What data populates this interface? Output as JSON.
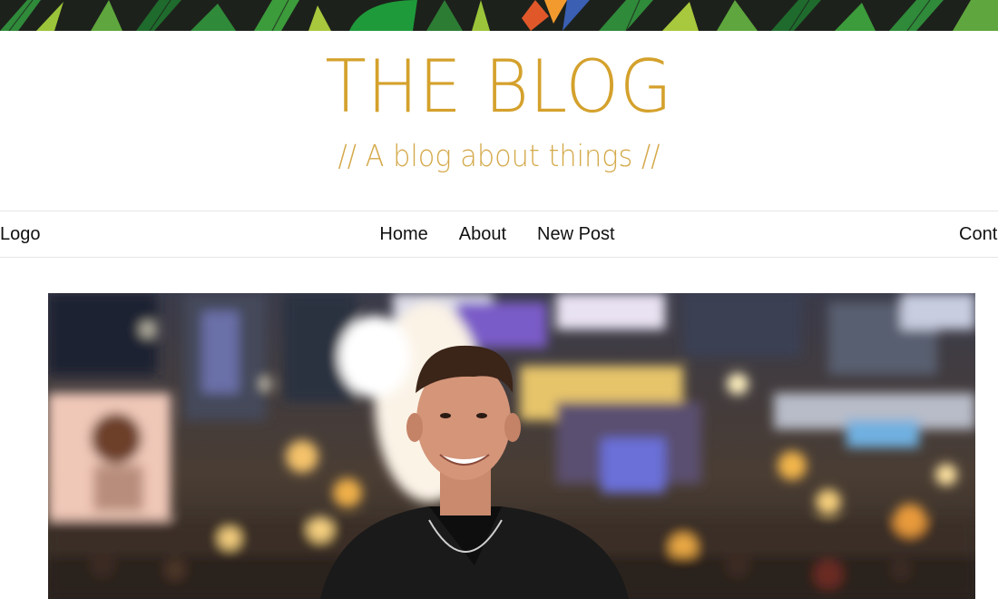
{
  "site": {
    "title": "THE BLOG",
    "tagline": "// A blog about things //",
    "title_color": "#d4a12c"
  },
  "nav": {
    "logo": "Logo",
    "links": [
      {
        "label": "Home"
      },
      {
        "label": "About"
      },
      {
        "label": "New Post"
      }
    ],
    "contact": "Cont"
  },
  "banner": {
    "icon": "tropical-leaves-banner"
  },
  "hero": {
    "icon": "photo-man-city-night"
  }
}
